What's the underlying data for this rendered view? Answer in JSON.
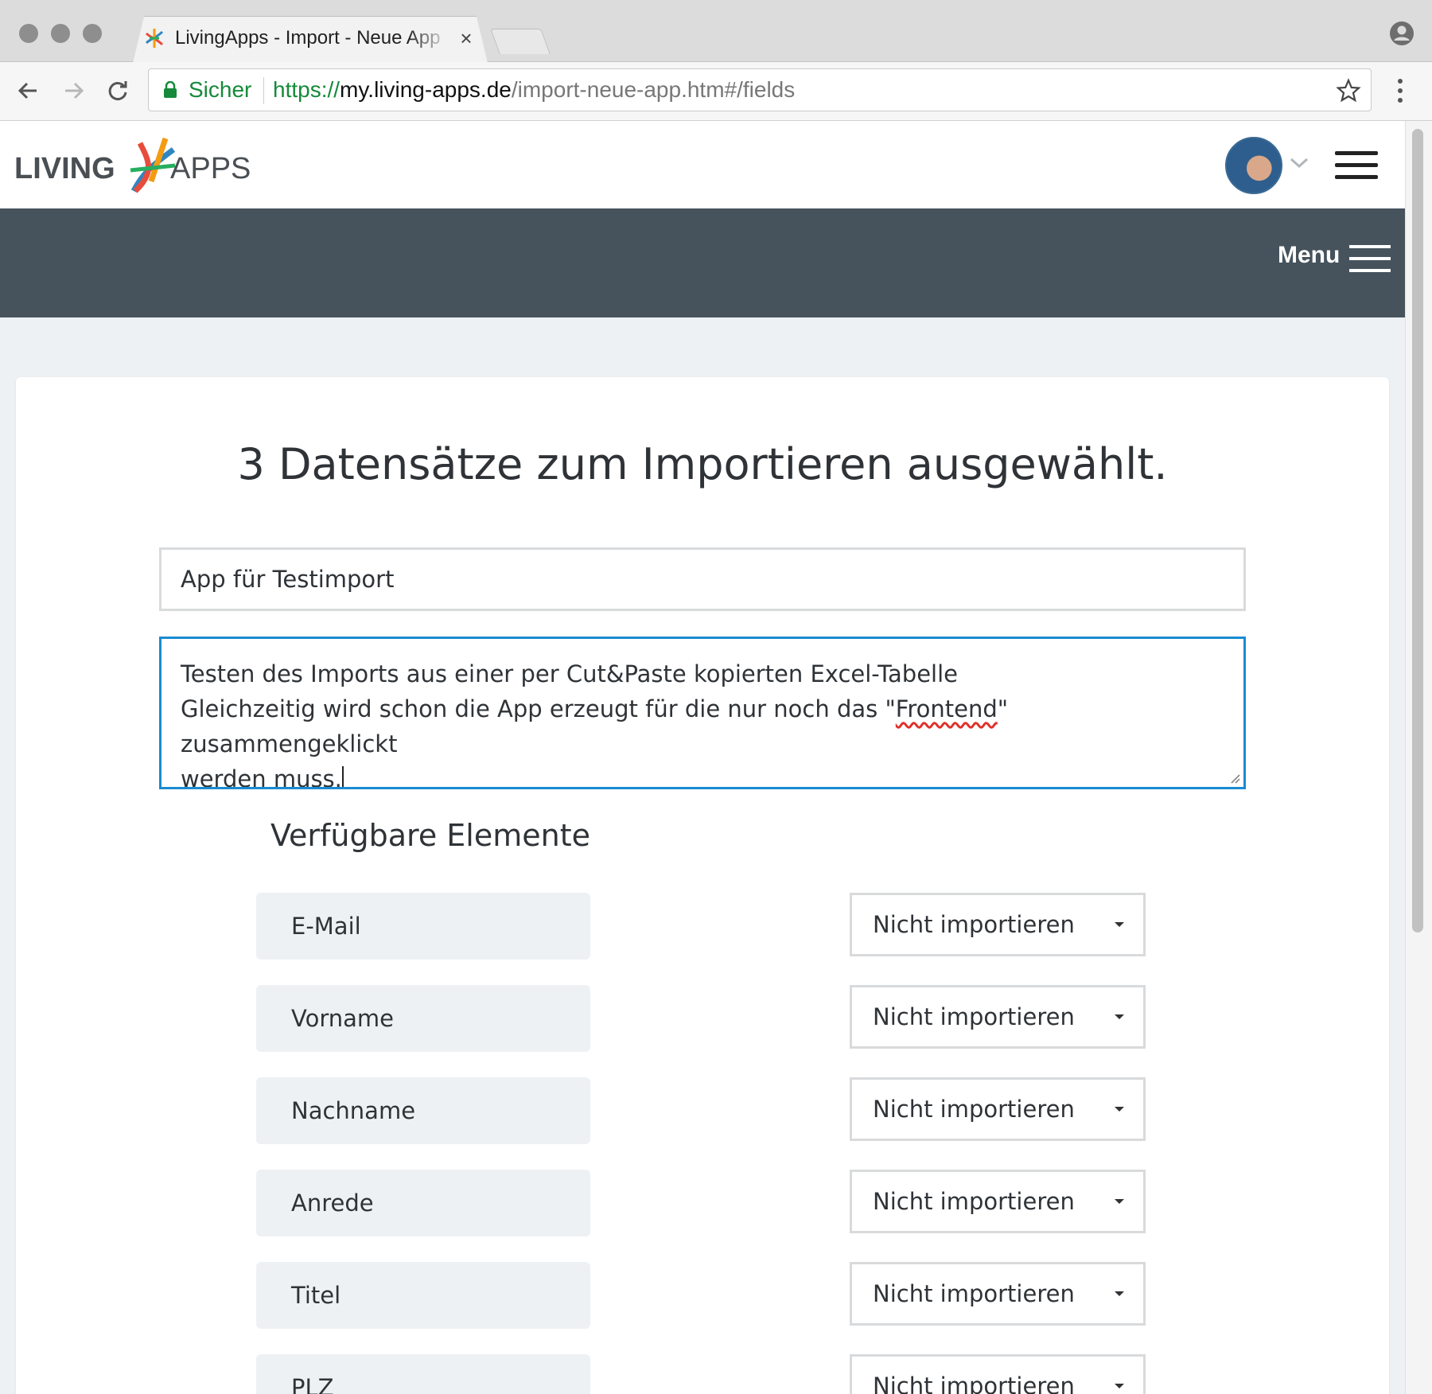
{
  "browser": {
    "tab_title": "LivingApps - Import - Neue App",
    "tab_close": "×",
    "secure_label": "Sicher",
    "url_scheme": "https://",
    "url_host": "my.living-apps.de",
    "url_path": "/import-neue-app.htm#/fields"
  },
  "navbar": {
    "menu_label": "Menu"
  },
  "import": {
    "heading": "3 Datensätze zum Importieren ausgewählt.",
    "app_name": "App für Testimport",
    "description_line1": "Testen des Imports aus einer per Cut&Paste kopierten Excel-Tabelle",
    "description_line2_before": "Gleichzeitig wird schon die App erzeugt für die nur noch das \"",
    "description_line2_spell": "Frontend",
    "description_line2_after": "\" zusammengeklickt",
    "description_line3": "werden muss.",
    "section_title": "Verfügbare Elemente",
    "fields": [
      {
        "label": "E-Mail",
        "mapping": "Nicht importieren"
      },
      {
        "label": "Vorname",
        "mapping": "Nicht importieren"
      },
      {
        "label": "Nachname",
        "mapping": "Nicht importieren"
      },
      {
        "label": "Anrede",
        "mapping": "Nicht importieren"
      },
      {
        "label": "Titel",
        "mapping": "Nicht importieren"
      },
      {
        "label": "PLZ",
        "mapping": "Nicht importieren"
      }
    ]
  },
  "colors": {
    "navbar_bg": "#46535d",
    "accent_focus": "#1a8bd2",
    "secure_green": "#168a3a",
    "page_bg": "#eef1f4"
  }
}
